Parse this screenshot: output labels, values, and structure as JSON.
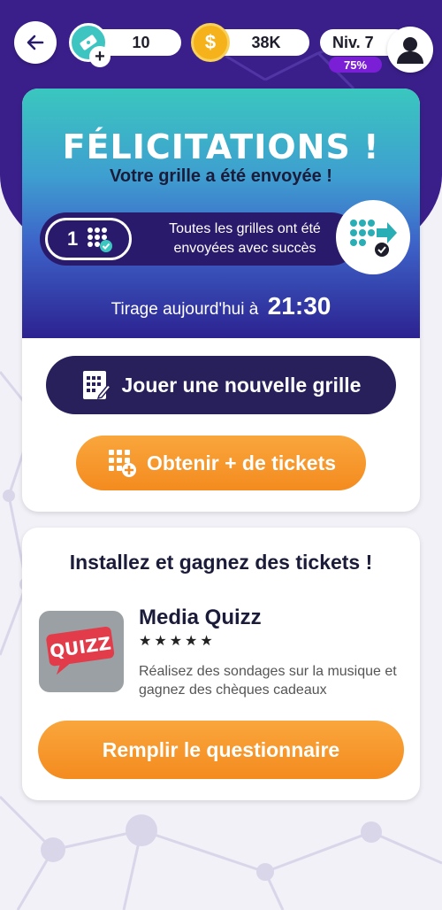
{
  "colors": {
    "header_bg": "#3a1f8a",
    "accent_orange": "#f48b1f",
    "dark_button": "#27205a",
    "teal": "#3ac7bf"
  },
  "topbar": {
    "back_icon": "arrow-left-icon",
    "tickets": {
      "icon": "ticket-icon",
      "value": "10",
      "plus": "+"
    },
    "coins": {
      "icon": "coin-icon",
      "symbol": "$",
      "value": "38K"
    },
    "level": {
      "label": "Niv. 7",
      "progress_text": "75%",
      "progress": 0.75
    },
    "avatar_icon": "user-avatar-icon"
  },
  "confirmation": {
    "title": "FÉLICITATIONS !",
    "subtitle": "Votre grille a été envoyée !",
    "grid_count": "1",
    "status_line1": "Toutes les grilles ont été",
    "status_line2": "envoyées avec succès",
    "send_icon": "grid-send-icon",
    "draw_label": "Tirage aujourd'hui à",
    "draw_time": "21:30",
    "play_button": "Jouer une nouvelle grille",
    "play_icon": "grid-notepad-icon",
    "tickets_button": "Obtenir + de tickets",
    "tickets_icon": "grid-plus-icon"
  },
  "offer": {
    "title": "Installez et gagnez des tickets !",
    "app_logo_text": "QUIZZ",
    "app_name": "Media Quizz",
    "stars": "★★★★★",
    "rating": 5,
    "description": "Réalisez des sondages sur la musique et gagnez des chèques cadeaux",
    "cta": "Remplir le questionnaire"
  }
}
